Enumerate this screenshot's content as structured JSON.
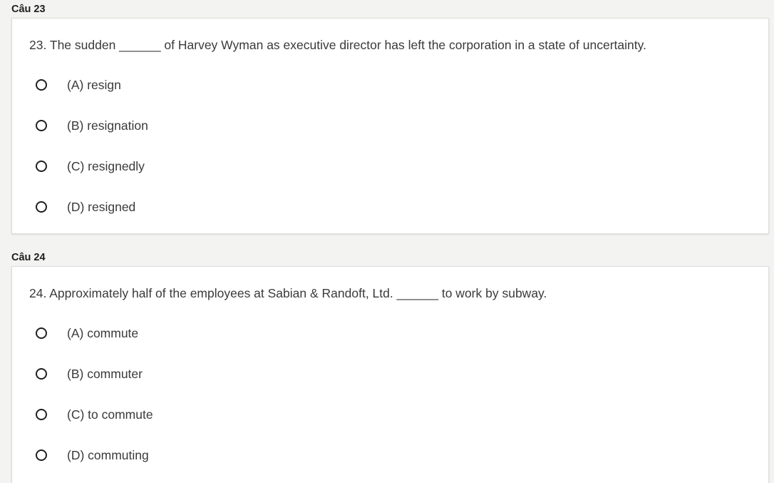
{
  "questions": [
    {
      "label": "Câu 23",
      "text": "23. The sudden ______ of Harvey Wyman as executive director has left the corporation in a state of uncertainty.",
      "options": [
        "(A) resign",
        "(B) resignation",
        "(C) resignedly",
        "(D) resigned"
      ]
    },
    {
      "label": "Câu 24",
      "text": "24. Approximately half of the employees at Sabian & Randoft, Ltd. ______ to work by subway.",
      "options": [
        "(A) commute",
        "(B) commuter",
        "(C) to commute",
        "(D) commuting"
      ]
    }
  ]
}
